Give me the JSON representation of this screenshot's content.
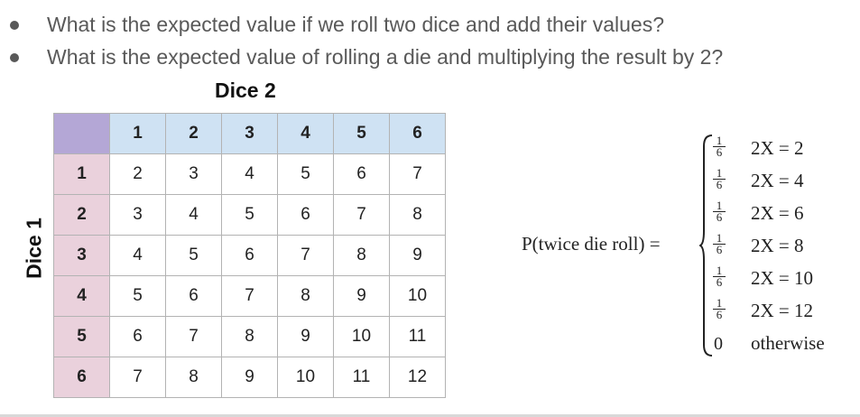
{
  "bullets": [
    "What is the expected value if we roll two dice and add their values?",
    "What is the expected value of rolling a die and multiplying the result by 2?"
  ],
  "table": {
    "column_axis_label": "Dice 2",
    "row_axis_label": "Dice 1",
    "column_headers": [
      "1",
      "2",
      "3",
      "4",
      "5",
      "6"
    ],
    "row_headers": [
      "1",
      "2",
      "3",
      "4",
      "5",
      "6"
    ],
    "rows": [
      [
        "2",
        "3",
        "4",
        "5",
        "6",
        "7"
      ],
      [
        "3",
        "4",
        "5",
        "6",
        "7",
        "8"
      ],
      [
        "4",
        "5",
        "6",
        "7",
        "8",
        "9"
      ],
      [
        "5",
        "6",
        "7",
        "8",
        "9",
        "10"
      ],
      [
        "6",
        "7",
        "8",
        "9",
        "10",
        "11"
      ],
      [
        "7",
        "8",
        "9",
        "10",
        "11",
        "12"
      ]
    ]
  },
  "formula": {
    "lhs": "P(twice die roll) =",
    "cases": [
      {
        "num": "1",
        "den": "6",
        "condition": "2X = 2"
      },
      {
        "num": "1",
        "den": "6",
        "condition": "2X = 4"
      },
      {
        "num": "1",
        "den": "6",
        "condition": "2X = 6"
      },
      {
        "num": "1",
        "den": "6",
        "condition": "2X = 8"
      },
      {
        "num": "1",
        "den": "6",
        "condition": "2X = 10"
      },
      {
        "num": "1",
        "den": "6",
        "condition": "2X = 12"
      }
    ],
    "otherwise": {
      "value": "0",
      "condition": "otherwise"
    }
  },
  "colors": {
    "corner": "#b4a7d6",
    "column_header": "#cfe2f3",
    "row_header": "#ead1dc",
    "border": "#b3b3b3"
  }
}
